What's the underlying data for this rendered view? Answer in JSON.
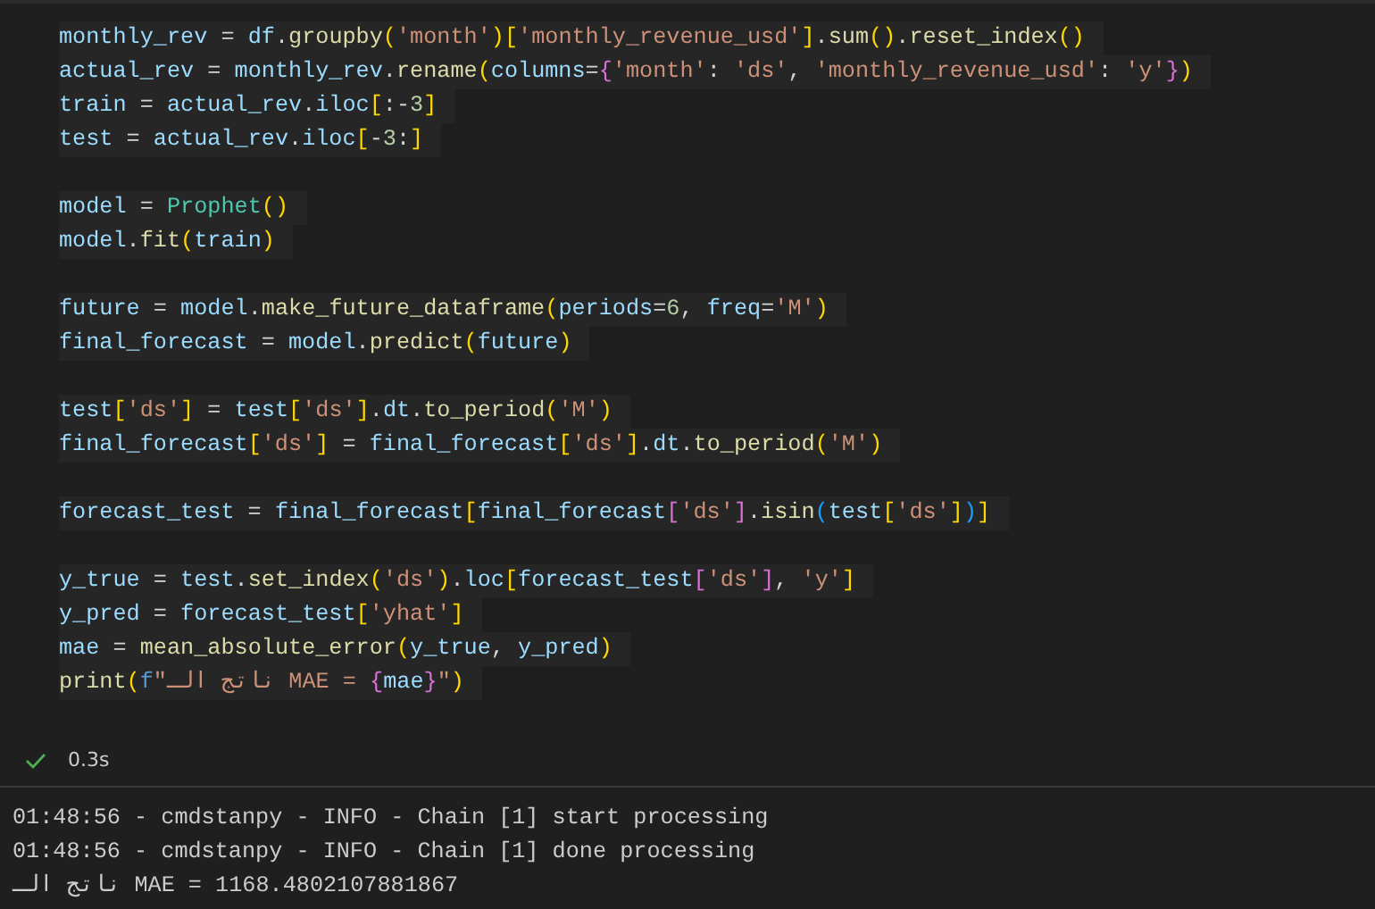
{
  "code_cell": {
    "lines": [
      {
        "kind": "code",
        "tokens": [
          {
            "text": "monthly_rev",
            "kind": "variable"
          },
          {
            "text": " = ",
            "kind": "plain"
          },
          {
            "text": "df",
            "kind": "variable"
          },
          {
            "text": ".",
            "kind": "plain"
          },
          {
            "text": "groupby",
            "kind": "function"
          },
          {
            "text": "(",
            "kind": "bracket"
          },
          {
            "text": "'month'",
            "kind": "string"
          },
          {
            "text": ")",
            "kind": "bracket"
          },
          {
            "text": "[",
            "kind": "bracket"
          },
          {
            "text": "'monthly_revenue_usd'",
            "kind": "string"
          },
          {
            "text": "]",
            "kind": "bracket"
          },
          {
            "text": ".",
            "kind": "plain"
          },
          {
            "text": "sum",
            "kind": "function"
          },
          {
            "text": "()",
            "kind": "bracket"
          },
          {
            "text": ".",
            "kind": "plain"
          },
          {
            "text": "reset_index",
            "kind": "function"
          },
          {
            "text": "()",
            "kind": "bracket"
          }
        ]
      },
      {
        "kind": "code",
        "tokens": [
          {
            "text": "actual_rev",
            "kind": "variable"
          },
          {
            "text": " = ",
            "kind": "plain"
          },
          {
            "text": "monthly_rev",
            "kind": "variable"
          },
          {
            "text": ".",
            "kind": "plain"
          },
          {
            "text": "rename",
            "kind": "function"
          },
          {
            "text": "(",
            "kind": "bracket"
          },
          {
            "text": "columns",
            "kind": "variable"
          },
          {
            "text": "=",
            "kind": "plain"
          },
          {
            "text": "{",
            "kind": "bracket2"
          },
          {
            "text": "'month'",
            "kind": "string"
          },
          {
            "text": ": ",
            "kind": "plain"
          },
          {
            "text": "'ds'",
            "kind": "string"
          },
          {
            "text": ", ",
            "kind": "plain"
          },
          {
            "text": "'monthly_revenue_usd'",
            "kind": "string"
          },
          {
            "text": ": ",
            "kind": "plain"
          },
          {
            "text": "'y'",
            "kind": "string"
          },
          {
            "text": "}",
            "kind": "bracket2"
          },
          {
            "text": ")",
            "kind": "bracket"
          }
        ]
      },
      {
        "kind": "code",
        "tokens": [
          {
            "text": "train",
            "kind": "variable"
          },
          {
            "text": " = ",
            "kind": "plain"
          },
          {
            "text": "actual_rev",
            "kind": "variable"
          },
          {
            "text": ".",
            "kind": "plain"
          },
          {
            "text": "iloc",
            "kind": "variable"
          },
          {
            "text": "[",
            "kind": "bracket"
          },
          {
            "text": ":-",
            "kind": "plain"
          },
          {
            "text": "3",
            "kind": "number"
          },
          {
            "text": "]",
            "kind": "bracket"
          }
        ]
      },
      {
        "kind": "code",
        "tokens": [
          {
            "text": "test",
            "kind": "variable"
          },
          {
            "text": " = ",
            "kind": "plain"
          },
          {
            "text": "actual_rev",
            "kind": "variable"
          },
          {
            "text": ".",
            "kind": "plain"
          },
          {
            "text": "iloc",
            "kind": "variable"
          },
          {
            "text": "[",
            "kind": "bracket"
          },
          {
            "text": "-",
            "kind": "plain"
          },
          {
            "text": "3",
            "kind": "number"
          },
          {
            "text": ":",
            "kind": "plain"
          },
          {
            "text": "]",
            "kind": "bracket"
          }
        ]
      },
      {
        "kind": "blank"
      },
      {
        "kind": "code",
        "tokens": [
          {
            "text": "model",
            "kind": "variable"
          },
          {
            "text": " = ",
            "kind": "plain"
          },
          {
            "text": "Prophet",
            "kind": "class"
          },
          {
            "text": "()",
            "kind": "bracket"
          }
        ]
      },
      {
        "kind": "code",
        "tokens": [
          {
            "text": "model",
            "kind": "variable"
          },
          {
            "text": ".",
            "kind": "plain"
          },
          {
            "text": "fit",
            "kind": "function"
          },
          {
            "text": "(",
            "kind": "bracket"
          },
          {
            "text": "train",
            "kind": "variable"
          },
          {
            "text": ")",
            "kind": "bracket"
          }
        ]
      },
      {
        "kind": "blank"
      },
      {
        "kind": "code",
        "tokens": [
          {
            "text": "future",
            "kind": "variable"
          },
          {
            "text": " = ",
            "kind": "plain"
          },
          {
            "text": "model",
            "kind": "variable"
          },
          {
            "text": ".",
            "kind": "plain"
          },
          {
            "text": "make_future_dataframe",
            "kind": "function"
          },
          {
            "text": "(",
            "kind": "bracket"
          },
          {
            "text": "periods",
            "kind": "variable"
          },
          {
            "text": "=",
            "kind": "plain"
          },
          {
            "text": "6",
            "kind": "number"
          },
          {
            "text": ", ",
            "kind": "plain"
          },
          {
            "text": "freq",
            "kind": "variable"
          },
          {
            "text": "=",
            "kind": "plain"
          },
          {
            "text": "'M'",
            "kind": "string"
          },
          {
            "text": ")",
            "kind": "bracket"
          }
        ]
      },
      {
        "kind": "code",
        "tokens": [
          {
            "text": "final_forecast",
            "kind": "variable"
          },
          {
            "text": " = ",
            "kind": "plain"
          },
          {
            "text": "model",
            "kind": "variable"
          },
          {
            "text": ".",
            "kind": "plain"
          },
          {
            "text": "predict",
            "kind": "function"
          },
          {
            "text": "(",
            "kind": "bracket"
          },
          {
            "text": "future",
            "kind": "variable"
          },
          {
            "text": ")",
            "kind": "bracket"
          }
        ]
      },
      {
        "kind": "blank"
      },
      {
        "kind": "code",
        "tokens": [
          {
            "text": "test",
            "kind": "variable"
          },
          {
            "text": "[",
            "kind": "bracket"
          },
          {
            "text": "'ds'",
            "kind": "string"
          },
          {
            "text": "]",
            "kind": "bracket"
          },
          {
            "text": " = ",
            "kind": "plain"
          },
          {
            "text": "test",
            "kind": "variable"
          },
          {
            "text": "[",
            "kind": "bracket"
          },
          {
            "text": "'ds'",
            "kind": "string"
          },
          {
            "text": "]",
            "kind": "bracket"
          },
          {
            "text": ".",
            "kind": "plain"
          },
          {
            "text": "dt",
            "kind": "variable"
          },
          {
            "text": ".",
            "kind": "plain"
          },
          {
            "text": "to_period",
            "kind": "function"
          },
          {
            "text": "(",
            "kind": "bracket"
          },
          {
            "text": "'M'",
            "kind": "string"
          },
          {
            "text": ")",
            "kind": "bracket"
          }
        ]
      },
      {
        "kind": "code",
        "tokens": [
          {
            "text": "final_forecast",
            "kind": "variable"
          },
          {
            "text": "[",
            "kind": "bracket"
          },
          {
            "text": "'ds'",
            "kind": "string"
          },
          {
            "text": "]",
            "kind": "bracket"
          },
          {
            "text": " = ",
            "kind": "plain"
          },
          {
            "text": "final_forecast",
            "kind": "variable"
          },
          {
            "text": "[",
            "kind": "bracket"
          },
          {
            "text": "'ds'",
            "kind": "string"
          },
          {
            "text": "]",
            "kind": "bracket"
          },
          {
            "text": ".",
            "kind": "plain"
          },
          {
            "text": "dt",
            "kind": "variable"
          },
          {
            "text": ".",
            "kind": "plain"
          },
          {
            "text": "to_period",
            "kind": "function"
          },
          {
            "text": "(",
            "kind": "bracket"
          },
          {
            "text": "'M'",
            "kind": "string"
          },
          {
            "text": ")",
            "kind": "bracket"
          }
        ]
      },
      {
        "kind": "blank"
      },
      {
        "kind": "code",
        "tokens": [
          {
            "text": "forecast_test",
            "kind": "variable"
          },
          {
            "text": " = ",
            "kind": "plain"
          },
          {
            "text": "final_forecast",
            "kind": "variable"
          },
          {
            "text": "[",
            "kind": "bracket"
          },
          {
            "text": "final_forecast",
            "kind": "variable"
          },
          {
            "text": "[",
            "kind": "bracket2"
          },
          {
            "text": "'ds'",
            "kind": "string"
          },
          {
            "text": "]",
            "kind": "bracket2"
          },
          {
            "text": ".",
            "kind": "plain"
          },
          {
            "text": "isin",
            "kind": "function"
          },
          {
            "text": "(",
            "kind": "bracket3"
          },
          {
            "text": "test",
            "kind": "variable"
          },
          {
            "text": "[",
            "kind": "bracket"
          },
          {
            "text": "'ds'",
            "kind": "string"
          },
          {
            "text": "]",
            "kind": "bracket"
          },
          {
            "text": ")",
            "kind": "bracket3"
          },
          {
            "text": "]",
            "kind": "bracket"
          }
        ]
      },
      {
        "kind": "blank"
      },
      {
        "kind": "code",
        "tokens": [
          {
            "text": "y_true",
            "kind": "variable"
          },
          {
            "text": " = ",
            "kind": "plain"
          },
          {
            "text": "test",
            "kind": "variable"
          },
          {
            "text": ".",
            "kind": "plain"
          },
          {
            "text": "set_index",
            "kind": "function"
          },
          {
            "text": "(",
            "kind": "bracket"
          },
          {
            "text": "'ds'",
            "kind": "string"
          },
          {
            "text": ")",
            "kind": "bracket"
          },
          {
            "text": ".",
            "kind": "plain"
          },
          {
            "text": "loc",
            "kind": "variable"
          },
          {
            "text": "[",
            "kind": "bracket"
          },
          {
            "text": "forecast_test",
            "kind": "variable"
          },
          {
            "text": "[",
            "kind": "bracket2"
          },
          {
            "text": "'ds'",
            "kind": "string"
          },
          {
            "text": "]",
            "kind": "bracket2"
          },
          {
            "text": ", ",
            "kind": "plain"
          },
          {
            "text": "'y'",
            "kind": "string"
          },
          {
            "text": "]",
            "kind": "bracket"
          }
        ]
      },
      {
        "kind": "code",
        "tokens": [
          {
            "text": "y_pred",
            "kind": "variable"
          },
          {
            "text": " = ",
            "kind": "plain"
          },
          {
            "text": "forecast_test",
            "kind": "variable"
          },
          {
            "text": "[",
            "kind": "bracket"
          },
          {
            "text": "'yhat'",
            "kind": "string"
          },
          {
            "text": "]",
            "kind": "bracket"
          }
        ]
      },
      {
        "kind": "code",
        "tokens": [
          {
            "text": "mae",
            "kind": "variable"
          },
          {
            "text": " = ",
            "kind": "plain"
          },
          {
            "text": "mean_absolute_error",
            "kind": "function"
          },
          {
            "text": "(",
            "kind": "bracket"
          },
          {
            "text": "y_true",
            "kind": "variable"
          },
          {
            "text": ", ",
            "kind": "plain"
          },
          {
            "text": "y_pred",
            "kind": "variable"
          },
          {
            "text": ")",
            "kind": "bracket"
          }
        ]
      },
      {
        "kind": "code",
        "tokens": [
          {
            "text": "print",
            "kind": "function"
          },
          {
            "text": "(",
            "kind": "bracket"
          },
          {
            "text": "f",
            "kind": "keyword"
          },
          {
            "text": "\"ناتج الـ MAE = ",
            "kind": "string"
          },
          {
            "text": "{",
            "kind": "bracket2"
          },
          {
            "text": "mae",
            "kind": "variable"
          },
          {
            "text": "}",
            "kind": "bracket2"
          },
          {
            "text": "\"",
            "kind": "string"
          },
          {
            "text": ")",
            "kind": "bracket"
          }
        ]
      }
    ]
  },
  "run_status": {
    "succeeded": true,
    "duration": "0.3s"
  },
  "output": {
    "lines": [
      "01:48:56 - cmdstanpy - INFO - Chain [1] start processing",
      "01:48:56 - cmdstanpy - INFO - Chain [1] done processing",
      "ناتج الـ MAE = 1168.4802107881867"
    ]
  }
}
